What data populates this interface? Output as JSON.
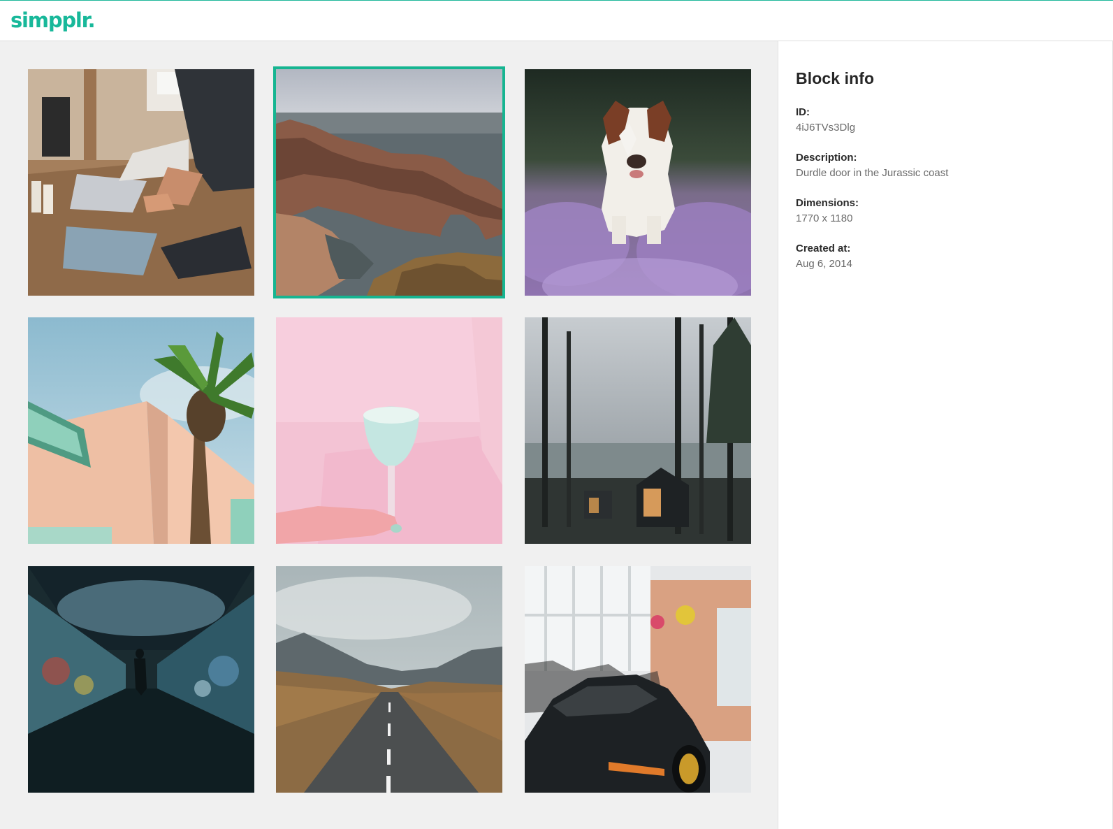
{
  "brand": {
    "logo_text": "simpplr.",
    "accent_color": "#18b89a"
  },
  "gallery": {
    "selected_index": 1,
    "items": [
      {
        "subject": "person working at laptop on desk"
      },
      {
        "subject": "sea arch on coast"
      },
      {
        "subject": "dog running through lavender"
      },
      {
        "subject": "palm tree beside pink building"
      },
      {
        "subject": "hand holding cocktail glass against pink wall"
      },
      {
        "subject": "cabin in misty forest"
      },
      {
        "subject": "person in graffiti tunnel"
      },
      {
        "subject": "road through mountain valley"
      },
      {
        "subject": "black sports car in showroom"
      }
    ]
  },
  "block_info": {
    "title": "Block info",
    "id_label": "ID:",
    "id_value": "4iJ6TVs3Dlg",
    "description_label": "Description:",
    "description_value": "Durdle door in the Jurassic coast",
    "dimensions_label": "Dimensions:",
    "dimensions_value": "1770 x 1180",
    "created_label": "Created at:",
    "created_value": "Aug 6, 2014"
  }
}
